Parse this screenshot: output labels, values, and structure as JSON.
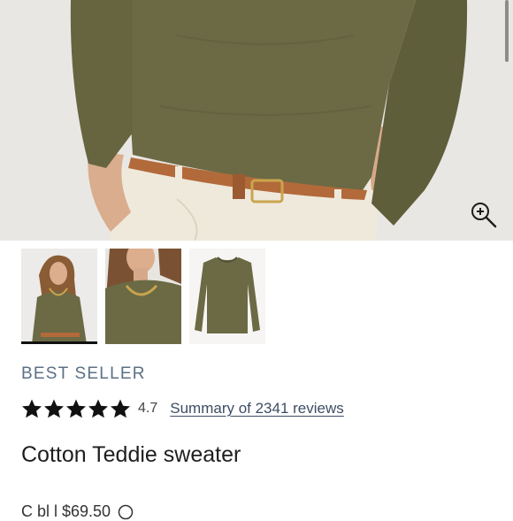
{
  "hero": {
    "scrollbar": "visible",
    "zoom_icon": "zoom-in-icon"
  },
  "thumbnails": [
    {
      "name": "thumb-model-front",
      "selected": true
    },
    {
      "name": "thumb-model-closeup",
      "selected": false
    },
    {
      "name": "thumb-flat-lay",
      "selected": false
    }
  ],
  "product": {
    "badge": "BEST SELLER",
    "rating_value": "4.7",
    "rating_stars": 5,
    "reviews_link": "Summary of 2341 reviews",
    "title": "Cotton Teddie sweater",
    "price_line_partial": "C          bl     l  $69.50",
    "info_icon": "info-icon"
  },
  "colors": {
    "badge": "#5c7085",
    "link": "#3d4d63",
    "sweater": "#6b6a45",
    "star": "#111111"
  }
}
